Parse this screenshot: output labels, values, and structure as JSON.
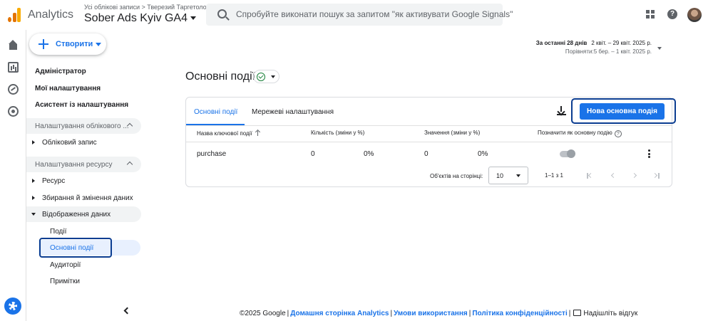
{
  "header": {
    "app_name": "Analytics",
    "breadcrumb": "Усі облікові записи > Тверезий Таргетолог",
    "property_name": "Sober Ads Kyiv GA4",
    "search_placeholder": "Спробуйте виконати пошук за запитом \"як активувати Google Signals\"",
    "icons": [
      "analytics-logo",
      "search-icon",
      "apps-grid-icon",
      "help-icon",
      "avatar"
    ]
  },
  "rail": {
    "icons": [
      "home-icon",
      "reports-icon",
      "explore-icon",
      "advertising-icon",
      "settings-icon"
    ]
  },
  "sidebar": {
    "create_label": "Створити",
    "top_items": [
      "Адміністратор",
      "Мої налаштування",
      "Асистент із налаштування"
    ],
    "account_section": "Налаштування облікового ...",
    "account_items": [
      "Обліковий запис"
    ],
    "property_section": "Налаштування ресурсу",
    "property_items": [
      "Ресурс",
      "Збирання й змінення даних",
      "Відображення даних"
    ],
    "display_subitems": [
      "Події",
      "Основні події",
      "Аудиторії",
      "Примітки"
    ],
    "active_item": "Основні події"
  },
  "date_range": {
    "label": "За останні 28 днів",
    "range": "2 квіт. – 29 квіт. 2025 р.",
    "compare": "Порівняти:5 бер. – 1 квіт. 2025 р."
  },
  "page": {
    "title": "Основні події",
    "status": "ok"
  },
  "card": {
    "tabs": [
      "Основні події",
      "Мережеві налаштування"
    ],
    "active_tab": 0,
    "primary_button": "Нова основна подія",
    "columns": [
      "Назва ключової події",
      "Кількість (зміни у %)",
      "Значення (зміни у %)",
      "Позначити як основну подію"
    ],
    "rows": [
      {
        "name": "purchase",
        "count": "0",
        "count_change": "0%",
        "value": "0",
        "value_change": "0%",
        "is_key": true
      }
    ],
    "pager": {
      "label": "Об'єктів на сторінці:",
      "page_size": "10",
      "range": "1–1 з 1"
    }
  },
  "footer": {
    "copyright": "©2025 Google",
    "links": [
      "Домашня сторінка Analytics",
      "Умови використання",
      "Політика конфіденційності"
    ],
    "feedback": "Надішліть відгук"
  },
  "colors": {
    "accent": "#1a73e8",
    "highlight_outline": "#0b3d91",
    "active_nav_bg": "#e8f0fe"
  }
}
